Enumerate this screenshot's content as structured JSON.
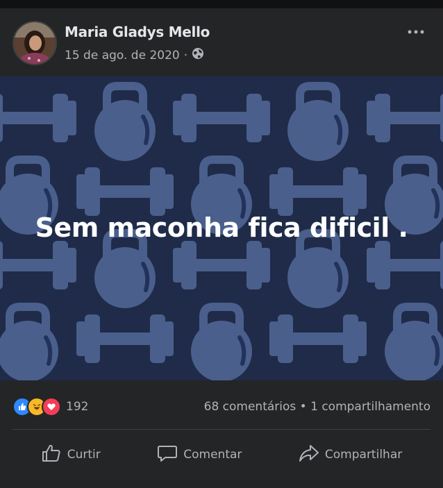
{
  "post": {
    "author": "Maria Gladys Mello",
    "date": "15 de ago. de 2020",
    "separator": "·",
    "privacy_icon": "globe-icon",
    "text": "Sem maconha fica dificil ."
  },
  "stats": {
    "reaction_icons": [
      "like-icon",
      "haha-icon",
      "love-icon"
    ],
    "reaction_count": "192",
    "comments": "68 comentários",
    "dot": "•",
    "shares": "1 compartilhamento"
  },
  "actions": {
    "like_label": "Curtir",
    "comment_label": "Comentar",
    "share_label": "Compartilhar"
  },
  "colors": {
    "card_bg": "#242526",
    "image_bg": "#1f2b48",
    "pattern": "#4a5f8c",
    "like_blue": "#2e89ff",
    "love_red": "#f33e58",
    "haha_yellow": "#f7b928"
  }
}
